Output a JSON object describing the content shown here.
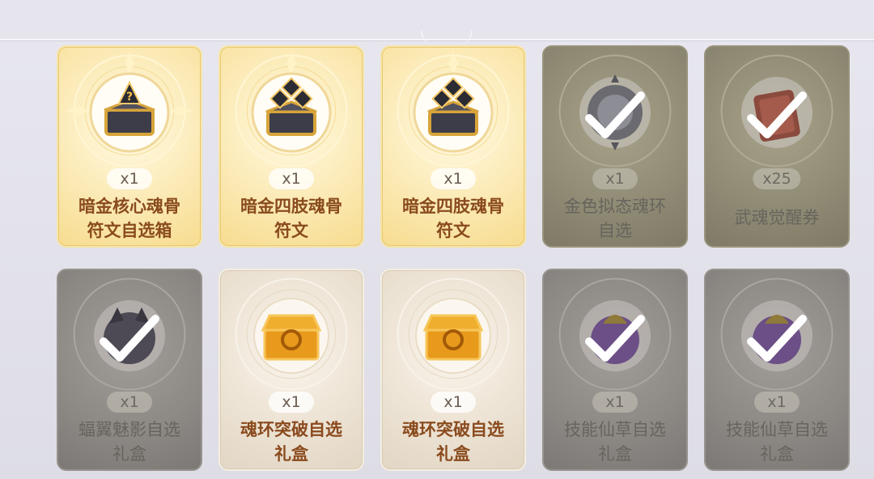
{
  "items": [
    {
      "name_line1": "暗金核心魂骨",
      "name_line2": "符文自选箱",
      "qty": "x1",
      "style": "gold",
      "icon": "dark-gold-chest-icon",
      "claimed": false
    },
    {
      "name_line1": "暗金四肢魂骨",
      "name_line2": "符文",
      "qty": "x1",
      "style": "gold",
      "icon": "dark-gold-chest-icon",
      "claimed": false
    },
    {
      "name_line1": "暗金四肢魂骨",
      "name_line2": "符文",
      "qty": "x1",
      "style": "gold",
      "icon": "dark-gold-chest-icon",
      "claimed": false
    },
    {
      "name_line1": "金色拟态魂环",
      "name_line2": "自选",
      "qty": "x1",
      "style": "claimed-olive",
      "icon": "soul-ring-orb-icon",
      "claimed": true
    },
    {
      "name_line1": "武魂觉醒券",
      "name_line2": "",
      "qty": "x25",
      "style": "claimed-olive",
      "icon": "awaken-ticket-icon",
      "claimed": true
    },
    {
      "name_line1": "蝠翼魅影自选",
      "name_line2": "礼盒",
      "qty": "x1",
      "style": "claimed-grey",
      "icon": "bat-wing-orb-icon",
      "claimed": true
    },
    {
      "name_line1": "魂环突破自选",
      "name_line2": "礼盒",
      "qty": "x1",
      "style": "pale",
      "icon": "golden-chest-icon",
      "claimed": false
    },
    {
      "name_line1": "魂环突破自选",
      "name_line2": "礼盒",
      "qty": "x1",
      "style": "pale",
      "icon": "golden-chest-icon",
      "claimed": false
    },
    {
      "name_line1": "技能仙草自选",
      "name_line2": "礼盒",
      "qty": "x1",
      "style": "claimed-grey",
      "icon": "herb-orb-icon",
      "claimed": true
    },
    {
      "name_line1": "技能仙草自选",
      "name_line2": "礼盒",
      "qty": "x1",
      "style": "claimed-grey",
      "icon": "herb-orb-icon",
      "claimed": true
    }
  ],
  "colors": {
    "gold_text": "#8a4b1e",
    "claimed_text": "#68645d"
  }
}
